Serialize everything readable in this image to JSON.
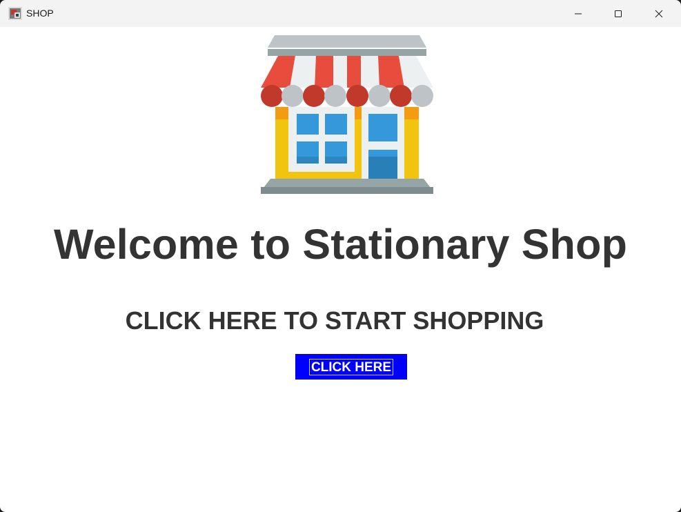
{
  "window": {
    "title": "SHOP",
    "controls": {
      "minimize": "minimize",
      "maximize": "maximize",
      "close": "close"
    }
  },
  "main": {
    "heading": "Welcome to Stationary Shop",
    "subheading": "CLICK HERE TO START SHOPPING",
    "button_label": "CLICK HERE"
  },
  "icons": {
    "app": "shop-app-icon",
    "illustration": "storefront-icon"
  },
  "colors": {
    "button_bg": "#0000ff",
    "text": "#333333",
    "awning_red": "#e74c3c",
    "window_blue": "#3498db",
    "wall_yellow": "#f1c40f"
  }
}
